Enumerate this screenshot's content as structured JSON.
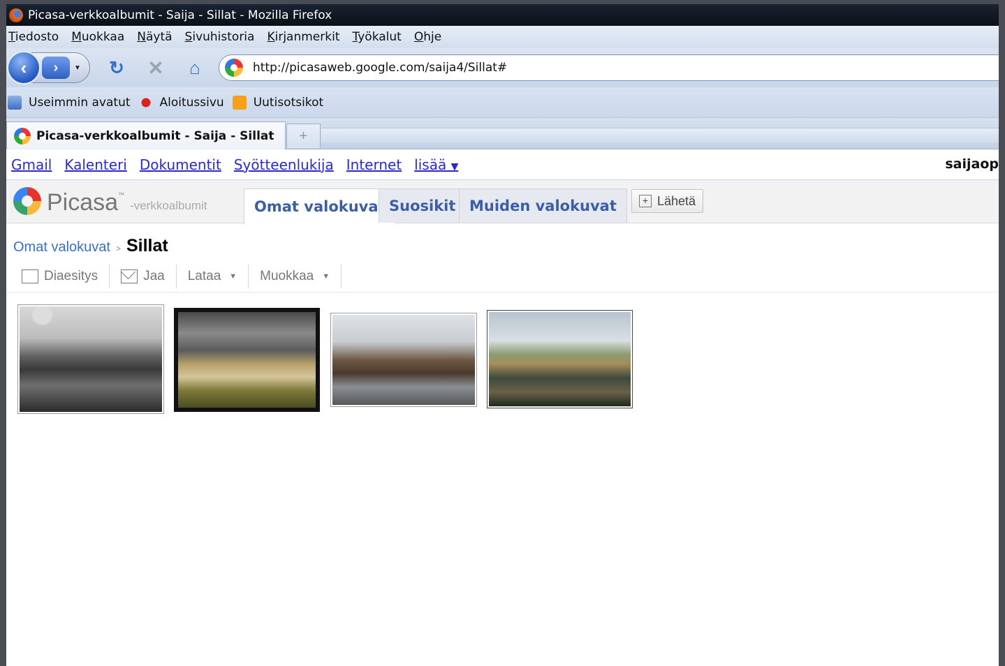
{
  "window": {
    "title": "Picasa-verkkoalbumit - Saija - Sillat - Mozilla Firefox"
  },
  "menu": {
    "items": [
      "Tiedosto",
      "Muokkaa",
      "Näytä",
      "Sivuhistoria",
      "Kirjanmerkit",
      "Työkalut",
      "Ohje"
    ]
  },
  "navbar": {
    "url": "http://picasaweb.google.com/saija4/Sillat#"
  },
  "bookmarks": {
    "items": [
      "Useimmin avatut",
      "Aloitussivu",
      "Uutisotsikot"
    ]
  },
  "tabs": {
    "active": "Picasa-verkkoalbumit - Saija - Sillat",
    "new_tab": "+"
  },
  "google_bar": {
    "links": [
      "Gmail",
      "Kalenteri",
      "Dokumentit",
      "Syötteenlukija",
      "Internet",
      "lisää"
    ],
    "more_arrow": "▼",
    "user": "saijaop"
  },
  "picasa": {
    "logo": "Picasa",
    "trademark": "™",
    "subtitle": "-verkkoalbumit",
    "tabs": [
      "Omat valokuvat",
      "Suosikit",
      "Muiden valokuvat"
    ],
    "upload_label": "Lähetä"
  },
  "breadcrumb": {
    "parent": "Omat valokuvat",
    "separator": ">",
    "current": "Sillat"
  },
  "album_toolbar": {
    "slideshow": "Diaesitys",
    "share": "Jaa",
    "download": "Lataa",
    "edit": "Muokkaa"
  },
  "photos": [
    {
      "alt": "bridge-photo-1"
    },
    {
      "alt": "bridge-photo-2"
    },
    {
      "alt": "bridge-photo-3"
    },
    {
      "alt": "bridge-photo-4"
    }
  ]
}
